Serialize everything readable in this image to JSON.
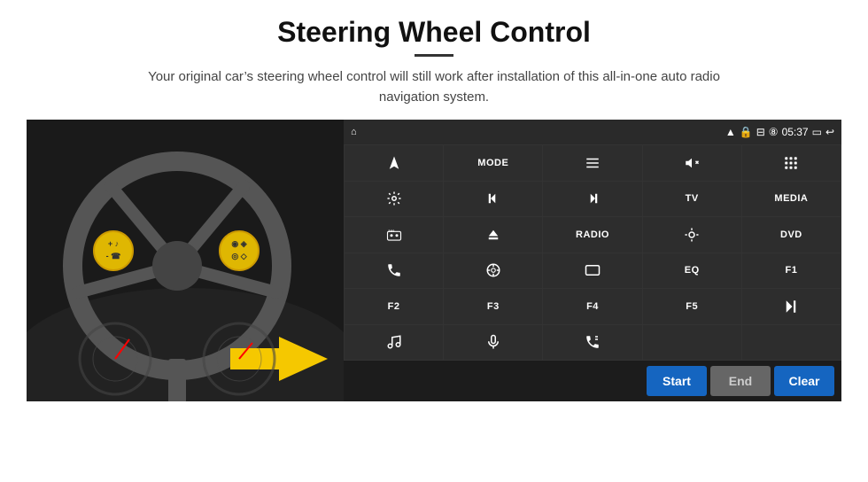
{
  "header": {
    "title": "Steering Wheel Control",
    "divider": true,
    "subtitle": "Your original car’s steering wheel control will still work after installation of this all-in-one auto radio navigation system."
  },
  "status_bar": {
    "home_icon": "⌂",
    "wifi_icon": "▲",
    "lock_icon": "🔒",
    "sd_icon": "⎕",
    "bt_icon": "⧅",
    "time": "05:37",
    "window_icon": "☐",
    "back_icon": "↩"
  },
  "grid_rows": [
    [
      {
        "label": "",
        "icon": "nav"
      },
      {
        "label": "MODE"
      },
      {
        "label": "",
        "icon": "list"
      },
      {
        "label": "",
        "icon": "mute"
      },
      {
        "label": "",
        "icon": "apps"
      }
    ],
    [
      {
        "label": "",
        "icon": "settings"
      },
      {
        "label": "",
        "icon": "prev"
      },
      {
        "label": "",
        "icon": "next"
      },
      {
        "label": "TV"
      },
      {
        "label": "MEDIA"
      }
    ],
    [
      {
        "label": "",
        "icon": "360cam"
      },
      {
        "label": "",
        "icon": "eject"
      },
      {
        "label": "RADIO"
      },
      {
        "label": "",
        "icon": "brightness"
      },
      {
        "label": "DVD"
      }
    ],
    [
      {
        "label": "",
        "icon": "phone"
      },
      {
        "label": "",
        "icon": "navi"
      },
      {
        "label": "",
        "icon": "screen"
      },
      {
        "label": "EQ"
      },
      {
        "label": "F1"
      }
    ],
    [
      {
        "label": "F2"
      },
      {
        "label": "F3"
      },
      {
        "label": "F4"
      },
      {
        "label": "F5"
      },
      {
        "label": "",
        "icon": "playpause"
      }
    ],
    [
      {
        "label": "",
        "icon": "music"
      },
      {
        "label": "",
        "icon": "mic"
      },
      {
        "label": "",
        "icon": "handsfree"
      },
      {
        "label": ""
      },
      {
        "label": ""
      }
    ]
  ],
  "action_bar": {
    "start_label": "Start",
    "end_label": "End",
    "clear_label": "Clear"
  }
}
